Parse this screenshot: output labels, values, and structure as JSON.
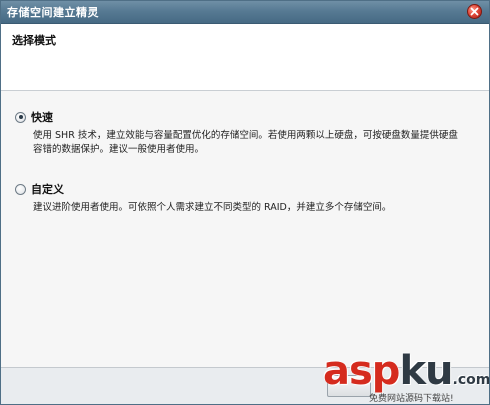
{
  "window": {
    "title": "存储空间建立精灵"
  },
  "header": {
    "heading": "选择模式"
  },
  "options": [
    {
      "label": "快速",
      "checked": true,
      "description": "使用 SHR 技术，建立效能与容量配置优化的存储空间。若使用两颗以上硬盘，可按硬盘数量提供硬盘容错的数据保护。建议一般使用者使用。"
    },
    {
      "label": "自定义",
      "checked": false,
      "description": "建议进阶使用者使用。可依照个人需求建立不同类型的 RAID，并建立多个存储空间。"
    }
  ],
  "watermark": {
    "logo_main": "asp",
    "logo_ku": "ku",
    "logo_suffix": ".com",
    "subtitle": "免费网站源码下载站!"
  },
  "icons": {
    "close": "close-icon"
  },
  "colors": {
    "titlebar": "#577a93",
    "close_button": "#e0483a",
    "watermark_red": "#d52b1e"
  }
}
